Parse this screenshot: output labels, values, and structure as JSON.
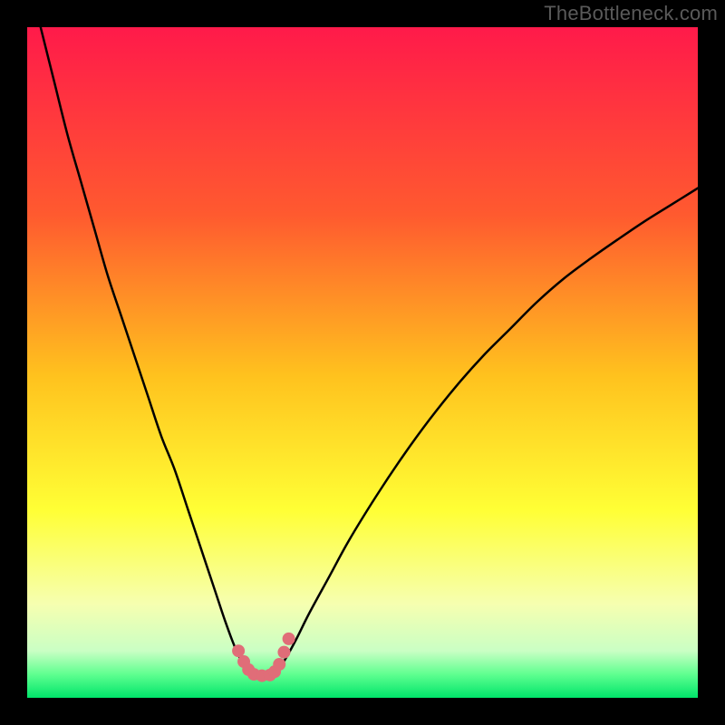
{
  "watermark": "TheBottleneck.com",
  "chart_data": {
    "type": "line",
    "title": "",
    "xlabel": "",
    "ylabel": "",
    "xlim": [
      0,
      100
    ],
    "ylim": [
      0,
      100
    ],
    "grid": false,
    "legend": false,
    "background_gradient": {
      "stops": [
        {
          "pos": 0.0,
          "color": "#ff1a4a"
        },
        {
          "pos": 0.28,
          "color": "#ff5a2f"
        },
        {
          "pos": 0.52,
          "color": "#ffc21e"
        },
        {
          "pos": 0.72,
          "color": "#ffff35"
        },
        {
          "pos": 0.86,
          "color": "#f6ffb0"
        },
        {
          "pos": 0.93,
          "color": "#caffc4"
        },
        {
          "pos": 0.965,
          "color": "#5fff90"
        },
        {
          "pos": 1.0,
          "color": "#00e56a"
        }
      ]
    },
    "series": [
      {
        "name": "left-branch",
        "stroke": "#000000",
        "x": [
          2,
          4,
          6,
          8,
          10,
          12,
          14,
          16,
          18,
          20,
          22,
          24,
          26,
          28,
          29.5,
          31,
          32.5,
          34
        ],
        "y": [
          100,
          92,
          84,
          77,
          70,
          63,
          57,
          51,
          45,
          39,
          34,
          28,
          22,
          16,
          11.5,
          7.5,
          4.5,
          3.5
        ]
      },
      {
        "name": "right-branch",
        "stroke": "#000000",
        "x": [
          36.5,
          38,
          40,
          42,
          45,
          48,
          52,
          56,
          60,
          64,
          68,
          72,
          76,
          80,
          84,
          88,
          92,
          96,
          100
        ],
        "y": [
          3.5,
          5,
          8.5,
          12.5,
          18,
          23.5,
          30,
          36,
          41.5,
          46.5,
          51,
          55,
          59,
          62.5,
          65.5,
          68.3,
          71,
          73.5,
          76
        ]
      },
      {
        "name": "valley-floor",
        "stroke": "#000000",
        "x": [
          34,
          35,
          36.5
        ],
        "y": [
          3.5,
          3.3,
          3.5
        ]
      }
    ],
    "marker_groups": [
      {
        "name": "valley-markers",
        "color": "#e06d78",
        "radius": 7,
        "points": [
          {
            "x": 31.5,
            "y": 7.0
          },
          {
            "x": 32.3,
            "y": 5.4
          },
          {
            "x": 33.0,
            "y": 4.2
          },
          {
            "x": 33.8,
            "y": 3.5
          },
          {
            "x": 35.0,
            "y": 3.3
          },
          {
            "x": 36.2,
            "y": 3.4
          },
          {
            "x": 36.9,
            "y": 3.9
          },
          {
            "x": 37.6,
            "y": 5.0
          },
          {
            "x": 38.3,
            "y": 6.8
          },
          {
            "x": 39.0,
            "y": 8.8
          }
        ]
      }
    ]
  }
}
